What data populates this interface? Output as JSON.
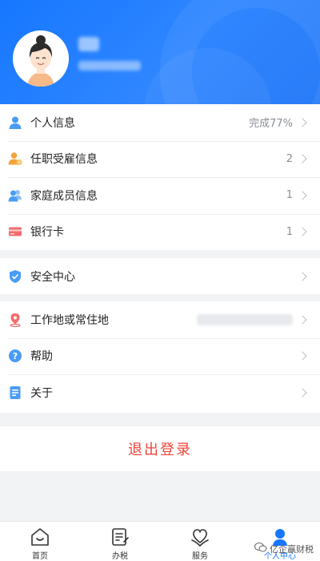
{
  "menu_group_1": [
    {
      "label": "个人信息",
      "value": "完成77%",
      "icon": "person-icon",
      "color": "#4a9cf5"
    },
    {
      "label": "任职受雇信息",
      "value": "2",
      "icon": "employment-icon",
      "color": "#f2a33a"
    },
    {
      "label": "家庭成员信息",
      "value": "1",
      "icon": "family-icon",
      "color": "#4a9cf5"
    },
    {
      "label": "银行卡",
      "value": "1",
      "icon": "bank-card-icon",
      "color": "#f26b6b"
    }
  ],
  "menu_group_2": [
    {
      "label": "安全中心",
      "icon": "shield-icon",
      "color": "#4a9cf5"
    }
  ],
  "menu_group_3": [
    {
      "label": "工作地或常住地",
      "icon": "location-icon",
      "color": "#f26b6b"
    },
    {
      "label": "帮助",
      "icon": "help-icon",
      "color": "#4a9cf5"
    },
    {
      "label": "关于",
      "icon": "about-icon",
      "color": "#4a9cf5"
    }
  ],
  "logout_label": "退出登录",
  "tabbar": [
    {
      "label": "首页",
      "icon": "home-icon"
    },
    {
      "label": "办税",
      "icon": "tax-icon"
    },
    {
      "label": "服务",
      "icon": "service-icon"
    },
    {
      "label": "个人中心",
      "icon": "profile-icon",
      "active": true
    }
  ],
  "watermark": "亿企赢财税",
  "colors": {
    "primary": "#1677ff",
    "danger": "#f0443a"
  }
}
